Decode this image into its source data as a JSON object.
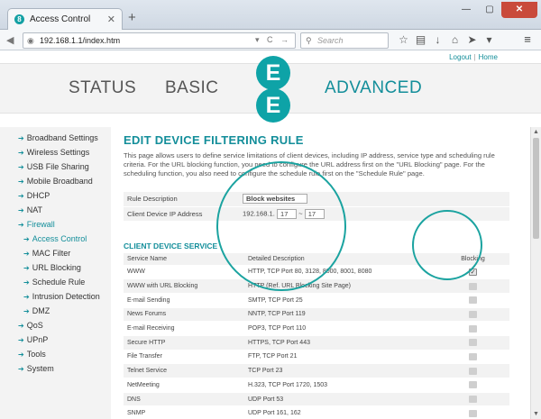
{
  "browser": {
    "tab_title": "Access Control",
    "tab_favicon": "8",
    "url": "192.168.1.1/index.htm",
    "search_placeholder": "Search",
    "new_tab": "+",
    "close": "✕",
    "minimize": "—",
    "maximize": "▢",
    "menu": "≡"
  },
  "top_links": {
    "logout": "Logout",
    "separator": "|",
    "home": "Home"
  },
  "nav": {
    "status": "STATUS",
    "basic": "BASIC",
    "advanced": "ADVANCED",
    "logo_letter": "E"
  },
  "sidebar": {
    "items": [
      {
        "label": "Broadband Settings"
      },
      {
        "label": "Wireless Settings"
      },
      {
        "label": "USB File Sharing"
      },
      {
        "label": "Mobile Broadband"
      },
      {
        "label": "DHCP"
      },
      {
        "label": "NAT"
      },
      {
        "label": "Firewall"
      },
      {
        "label": "Access Control"
      },
      {
        "label": "MAC Filter"
      },
      {
        "label": "URL Blocking"
      },
      {
        "label": "Schedule Rule"
      },
      {
        "label": "Intrusion Detection"
      },
      {
        "label": "DMZ"
      },
      {
        "label": "QoS"
      },
      {
        "label": "UPnP"
      },
      {
        "label": "Tools"
      },
      {
        "label": "System"
      }
    ]
  },
  "main": {
    "heading": "EDIT DEVICE FILTERING RULE",
    "description": "This page allows users to define service limitations of client devices, including IP address, service type and scheduling rule criteria. For the URL blocking function, you need to configure the URL address first on the \"URL Blocking\" page. For the scheduling function, you also need to configure the schedule rule first on the \"Schedule Rule\" page.",
    "rule_description_label": "Rule Description",
    "rule_description_value": "Block websites",
    "client_ip_label": "Client Device IP Address",
    "ip_prefix": "192.168.1.",
    "ip_from": "17",
    "ip_separator": "~",
    "ip_to": "17",
    "service_heading": "CLIENT DEVICE SERVICE",
    "columns": {
      "service": "Service Name",
      "detail": "Detailed Description",
      "blocking": "Blocking"
    },
    "services": [
      {
        "name": "WWW",
        "detail": "HTTP, TCP Port 80, 3128, 8000, 8001, 8080",
        "blocked": true
      },
      {
        "name": "WWW with URL Blocking",
        "detail": "HTTP (Ref. URL Blocking Site Page)",
        "blocked": false
      },
      {
        "name": "E-mail Sending",
        "detail": "SMTP, TCP Port 25",
        "blocked": false
      },
      {
        "name": "News Forums",
        "detail": "NNTP, TCP Port 119",
        "blocked": false
      },
      {
        "name": "E-mail Receiving",
        "detail": "POP3, TCP Port 110",
        "blocked": false
      },
      {
        "name": "Secure HTTP",
        "detail": "HTTPS, TCP Port 443",
        "blocked": false
      },
      {
        "name": "File Transfer",
        "detail": "FTP, TCP Port 21",
        "blocked": false
      },
      {
        "name": "Telnet Service",
        "detail": "TCP Port 23",
        "blocked": false
      },
      {
        "name": "NetMeeting",
        "detail": "H.323, TCP Port 1720, 1503",
        "blocked": false
      },
      {
        "name": "DNS",
        "detail": "UDP Port 53",
        "blocked": false
      },
      {
        "name": "SNMP",
        "detail": "UDP Port 161, 162",
        "blocked": false
      }
    ]
  },
  "colors": {
    "accent": "#138e9a",
    "logo": "#0ea3a7",
    "annotation_circle": "#1ba3a0"
  }
}
